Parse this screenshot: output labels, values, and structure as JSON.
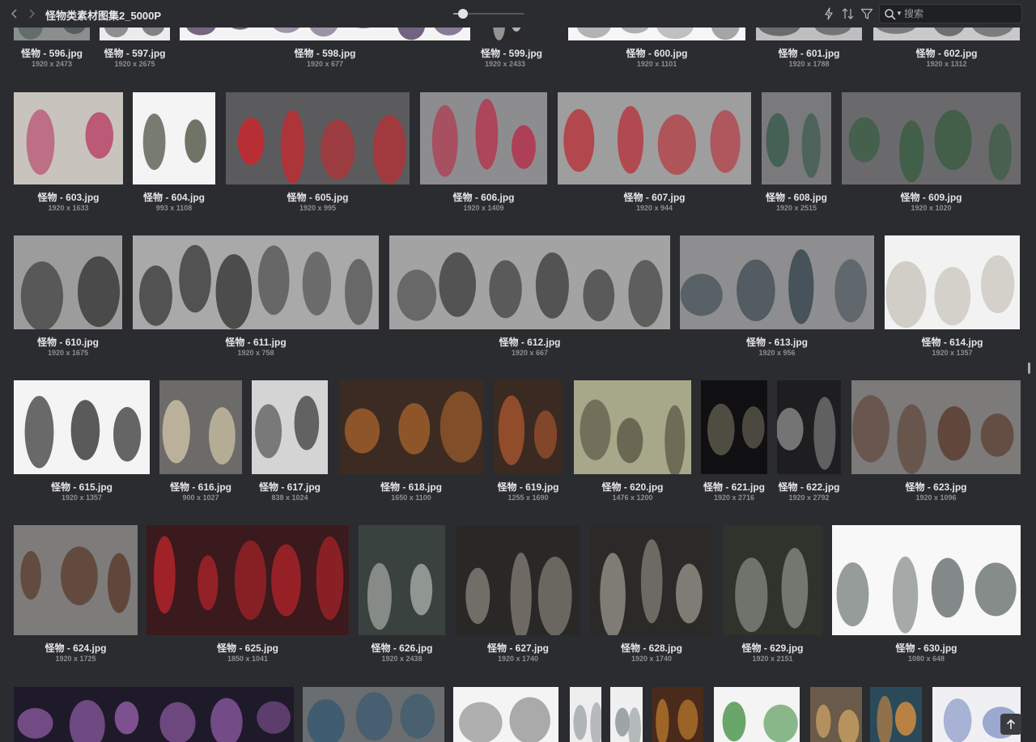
{
  "window": {
    "title": "怪物类素材图集2_5000P"
  },
  "toolbar": {
    "back_icon": "chevron-left-icon",
    "forward_icon": "chevron-right-icon",
    "zoom_slider_value": 0.14,
    "lightning_icon": "lightning-icon",
    "sort_icon": "sort-icon",
    "filter_icon": "filter-icon",
    "search_icon": "search-icon",
    "search_placeholder": "搜索",
    "search_value": ""
  },
  "colors": {
    "background": "#2b2c2f",
    "text": "#e4e4e4",
    "muted": "#8d8e92"
  },
  "rows": [
    {
      "items": [
        {
          "name": "怪物 - 596.jpg",
          "dims": "1920 x 2473",
          "tone": "#8a8e8c",
          "ink": "#4d5a56"
        },
        {
          "name": "怪物 - 597.jpg",
          "dims": "1920 x 2675",
          "tone": "#ececec",
          "ink": "#707070"
        },
        {
          "name": "怪物 - 598.jpg",
          "dims": "1920 x 677",
          "tone": "#f4f4f4",
          "ink": "#5f4d70"
        },
        {
          "name": "怪物 - 599.jpg",
          "dims": "1920 x 2433",
          "tone": "#2a2a2a",
          "ink": "#d4d4d4"
        },
        {
          "name": "怪物 - 600.jpg",
          "dims": "1920 x 1101",
          "tone": "#f6f6f6",
          "ink": "#9a9a9a"
        },
        {
          "name": "怪物 - 601.jpg",
          "dims": "1920 x 1788",
          "tone": "#bebebe",
          "ink": "#5a5a5a"
        },
        {
          "name": "怪物 - 602.jpg",
          "dims": "1920 x 1312",
          "tone": "#c9c9c9",
          "ink": "#4a4a4a"
        }
      ]
    },
    {
      "items": [
        {
          "name": "怪物 - 603.jpg",
          "dims": "1920 x 1633",
          "tone": "#c9c3bd",
          "ink": "#b8466a"
        },
        {
          "name": "怪物 - 604.jpg",
          "dims": "993 x 1108",
          "tone": "#f4f4f4",
          "ink": "#555a4a"
        },
        {
          "name": "怪物 - 605.jpg",
          "dims": "1920 x 995",
          "tone": "#5b5b5d",
          "ink": "#c22a30"
        },
        {
          "name": "怪物 - 606.jpg",
          "dims": "1920 x 1409",
          "tone": "#8d8d8f",
          "ink": "#b5304a"
        },
        {
          "name": "怪物 - 607.jpg",
          "dims": "1920 x 944",
          "tone": "#9e9e9e",
          "ink": "#b82c34"
        },
        {
          "name": "怪物 - 608.jpg",
          "dims": "1920 x 2515",
          "tone": "#7a7a7c",
          "ink": "#3d5c4e"
        },
        {
          "name": "怪物 - 609.jpg",
          "dims": "1920 x 1020",
          "tone": "#6a6a6c",
          "ink": "#2f5a3a"
        }
      ]
    },
    {
      "items": [
        {
          "name": "怪物 - 610.jpg",
          "dims": "1920 x 1675",
          "tone": "#9c9c9c",
          "ink": "#3a3a3a"
        },
        {
          "name": "怪物 - 611.jpg",
          "dims": "1920 x 758",
          "tone": "#a9a9a9",
          "ink": "#3c3c3c"
        },
        {
          "name": "怪物 - 612.jpg",
          "dims": "1920 x 667",
          "tone": "#a3a3a3",
          "ink": "#3a3a3a"
        },
        {
          "name": "怪物 - 613.jpg",
          "dims": "1920 x 956",
          "tone": "#8e8e90",
          "ink": "#3d4a52"
        },
        {
          "name": "怪物 - 614.jpg",
          "dims": "1920 x 1357",
          "tone": "#f2f2f2",
          "ink": "#c8c4bc"
        }
      ]
    },
    {
      "items": [
        {
          "name": "怪物 - 615.jpg",
          "dims": "1920 x 1357",
          "tone": "#f4f4f4",
          "ink": "#333333"
        },
        {
          "name": "怪物 - 616.jpg",
          "dims": "900 x 1027",
          "tone": "#6c6b69",
          "ink": "#cbbfa4"
        },
        {
          "name": "怪物 - 617.jpg",
          "dims": "838 x 1024",
          "tone": "#d4d4d4",
          "ink": "#3a3a3a"
        },
        {
          "name": "怪物 - 618.jpg",
          "dims": "1650 x 1100",
          "tone": "#3b2b22",
          "ink": "#b0682c"
        },
        {
          "name": "怪物 - 619.jpg",
          "dims": "1255 x 1690",
          "tone": "#3a2a22",
          "ink": "#a5542e"
        },
        {
          "name": "怪物 - 620.jpg",
          "dims": "1476 x 1200",
          "tone": "#a7a88a",
          "ink": "#4a4636"
        },
        {
          "name": "怪物 - 621.jpg",
          "dims": "1920 x 2716",
          "tone": "#101012",
          "ink": "#6d6a5a"
        },
        {
          "name": "怪物 - 622.jpg",
          "dims": "1920 x 2792",
          "tone": "#1e1e20",
          "ink": "#8c8c8c"
        },
        {
          "name": "怪物 - 623.jpg",
          "dims": "1920 x 1096",
          "tone": "#7c7b7a",
          "ink": "#5a3a2c"
        }
      ]
    },
    {
      "items": [
        {
          "name": "怪物 - 624.jpg",
          "dims": "1920 x 1725",
          "tone": "#7e7c7a",
          "ink": "#5a3a2c"
        },
        {
          "name": "怪物 - 625.jpg",
          "dims": "1850 x 1041",
          "tone": "#3a1a1c",
          "ink": "#b0242a"
        },
        {
          "name": "怪物 - 626.jpg",
          "dims": "1920 x 2438",
          "tone": "#3a4240",
          "ink": "#b4b8b4"
        },
        {
          "name": "怪物 - 627.jpg",
          "dims": "1920 x 1740",
          "tone": "#2a2826",
          "ink": "#8c8880"
        },
        {
          "name": "怪物 - 628.jpg",
          "dims": "1920 x 1740",
          "tone": "#2c2a28",
          "ink": "#8f8b84"
        },
        {
          "name": "怪物 - 629.jpg",
          "dims": "1920 x 2151",
          "tone": "#2e342c",
          "ink": "#9a9e96"
        },
        {
          "name": "怪物 - 630.jpg",
          "dims": "1080 x 648",
          "tone": "#f8f8f8",
          "ink": "#6e7674"
        }
      ]
    },
    {
      "items": [
        {
          "name": "",
          "dims": "",
          "tone": "#1e1a2a",
          "ink": "#8c5aa0"
        },
        {
          "name": "",
          "dims": "",
          "tone": "#6a6e70",
          "ink": "#3a5a70"
        },
        {
          "name": "",
          "dims": "",
          "tone": "#f4f4f4",
          "ink": "#888888"
        },
        {
          "name": "",
          "dims": "",
          "tone": "#eeeeee",
          "ink": "#9aa0a4"
        },
        {
          "name": "",
          "dims": "",
          "tone": "#f0f0f0",
          "ink": "#90989a"
        },
        {
          "name": "",
          "dims": "",
          "tone": "#4a2a1a",
          "ink": "#d08a30"
        },
        {
          "name": "",
          "dims": "",
          "tone": "#f4f4f4",
          "ink": "#3a8a3a"
        },
        {
          "name": "",
          "dims": "",
          "tone": "#6a5a4a",
          "ink": "#c09a60"
        },
        {
          "name": "",
          "dims": "",
          "tone": "#2a4a5a",
          "ink": "#d08a40"
        },
        {
          "name": "",
          "dims": "",
          "tone": "#f0f0f4",
          "ink": "#8a9ac8"
        }
      ]
    }
  ]
}
